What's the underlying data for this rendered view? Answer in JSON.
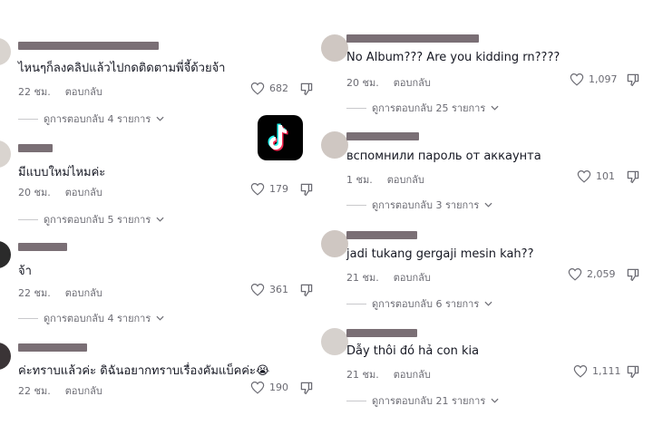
{
  "tiktok_logo": "tiktok-logo",
  "left": [
    {
      "text": "ไหนๆก็ลงคลิปแล้วไปกดติดตามพี่จี้ด้วยจ้า",
      "time": "22 ชม.",
      "reply": "ตอบกลับ",
      "likes": "682",
      "view": "ดูการตอบกลับ 4 รายการ"
    },
    {
      "text": "มีแบบใหม่ไหมค่ะ",
      "time": "20 ชม.",
      "reply": "ตอบกลับ",
      "likes": "179",
      "view": "ดูการตอบกลับ 5 รายการ"
    },
    {
      "text": "จ้า",
      "time": "22 ชม.",
      "reply": "ตอบกลับ",
      "likes": "361",
      "view": "ดูการตอบกลับ 4 รายการ"
    },
    {
      "text": "ค่ะทราบแล้วค่ะ ดิฉันอยากทราบเรื่องคัมแบ็คค่ะ😭",
      "time": "22 ชม.",
      "reply": "ตอบกลับ",
      "likes": "190",
      "view": ""
    }
  ],
  "right": [
    {
      "text": "No Album??? Are you kidding rn????",
      "time": "20 ชม.",
      "reply": "ตอบกลับ",
      "likes": "1,097",
      "view": "ดูการตอบกลับ 25 รายการ"
    },
    {
      "text": "вспомнили пароль от аккаунта",
      "time": "1 ชม.",
      "reply": "ตอบกลับ",
      "likes": "101",
      "view": "ดูการตอบกลับ 3 รายการ"
    },
    {
      "text": "jadi tukang gergaji mesin kah??",
      "time": "21 ชม.",
      "reply": "ตอบกลับ",
      "likes": "2,059",
      "view": "ดูการตอบกลับ 6 รายการ"
    },
    {
      "text": "Dẫy thôi đó hả con kia",
      "time": "21 ชม.",
      "reply": "ตอบกลับ",
      "likes": "1,111",
      "view": "ดูการตอบกลับ 21 รายการ"
    }
  ]
}
